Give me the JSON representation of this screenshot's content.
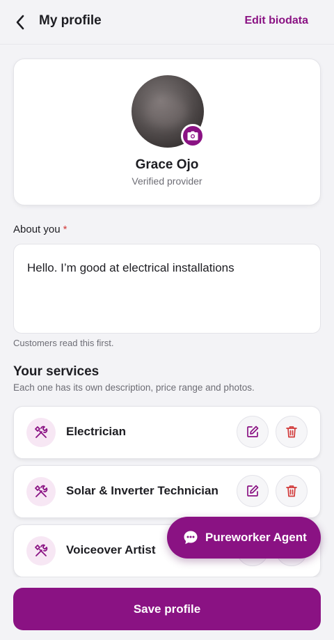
{
  "header": {
    "title": "My profile",
    "edit_label": "Edit biodata"
  },
  "profile": {
    "name": "Grace Ojo",
    "status": "Verified provider"
  },
  "about": {
    "label": "About you",
    "required_mark": "*",
    "text": "Hello. I’m good at electrical installations",
    "hint": "Customers read this first."
  },
  "services": {
    "title": "Your services",
    "subtitle": "Each one has its own description, price range and photos.",
    "items": [
      {
        "name": "Electrician"
      },
      {
        "name": "Solar & Inverter Technician"
      },
      {
        "name": "Voiceover Artist"
      }
    ]
  },
  "agent": {
    "label": "Pureworker Agent"
  },
  "footer": {
    "save_label": "Save profile"
  },
  "colors": {
    "accent": "#8a1283",
    "delete": "#d23b3b",
    "background": "#f3f3f6"
  }
}
